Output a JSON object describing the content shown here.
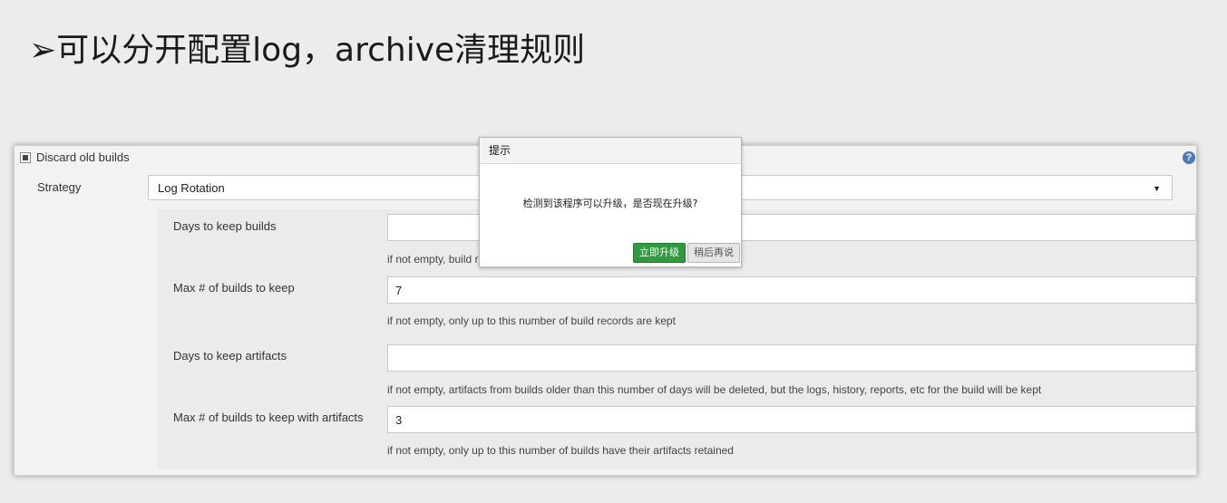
{
  "slide": {
    "title": "➢可以分开配置log，archive清理规则"
  },
  "panel": {
    "discard_label": "Discard old builds",
    "strategy_label": "Strategy",
    "strategy_value": "Log Rotation",
    "fields": [
      {
        "label": "Days to keep builds",
        "value": "",
        "help": "if not empty, build records are only kept up to this number of days"
      },
      {
        "label": "Max # of builds to keep",
        "value": "7",
        "help": "if not empty, only up to this number of build records are kept"
      },
      {
        "label": "Days to keep artifacts",
        "value": "",
        "help": "if not empty, artifacts from builds older than this number of days will be deleted, but the logs, history, reports, etc for the build will be kept"
      },
      {
        "label": "Max # of builds to keep with artifacts",
        "value": "3",
        "help": "if not empty, only up to this number of builds have their artifacts retained"
      }
    ]
  },
  "dialog": {
    "title": "提示",
    "message": "检测到该程序可以升级，是否现在升级?",
    "ok_label": "立即升级",
    "later_label": "稍后再说"
  },
  "icons": {
    "help": "question-icon",
    "select_caret": "caret-down-icon",
    "checkbox": "checkbox-checked-icon"
  },
  "colors": {
    "primary_button": "#2f9a3e",
    "help_icon": "#4a7ab8"
  }
}
